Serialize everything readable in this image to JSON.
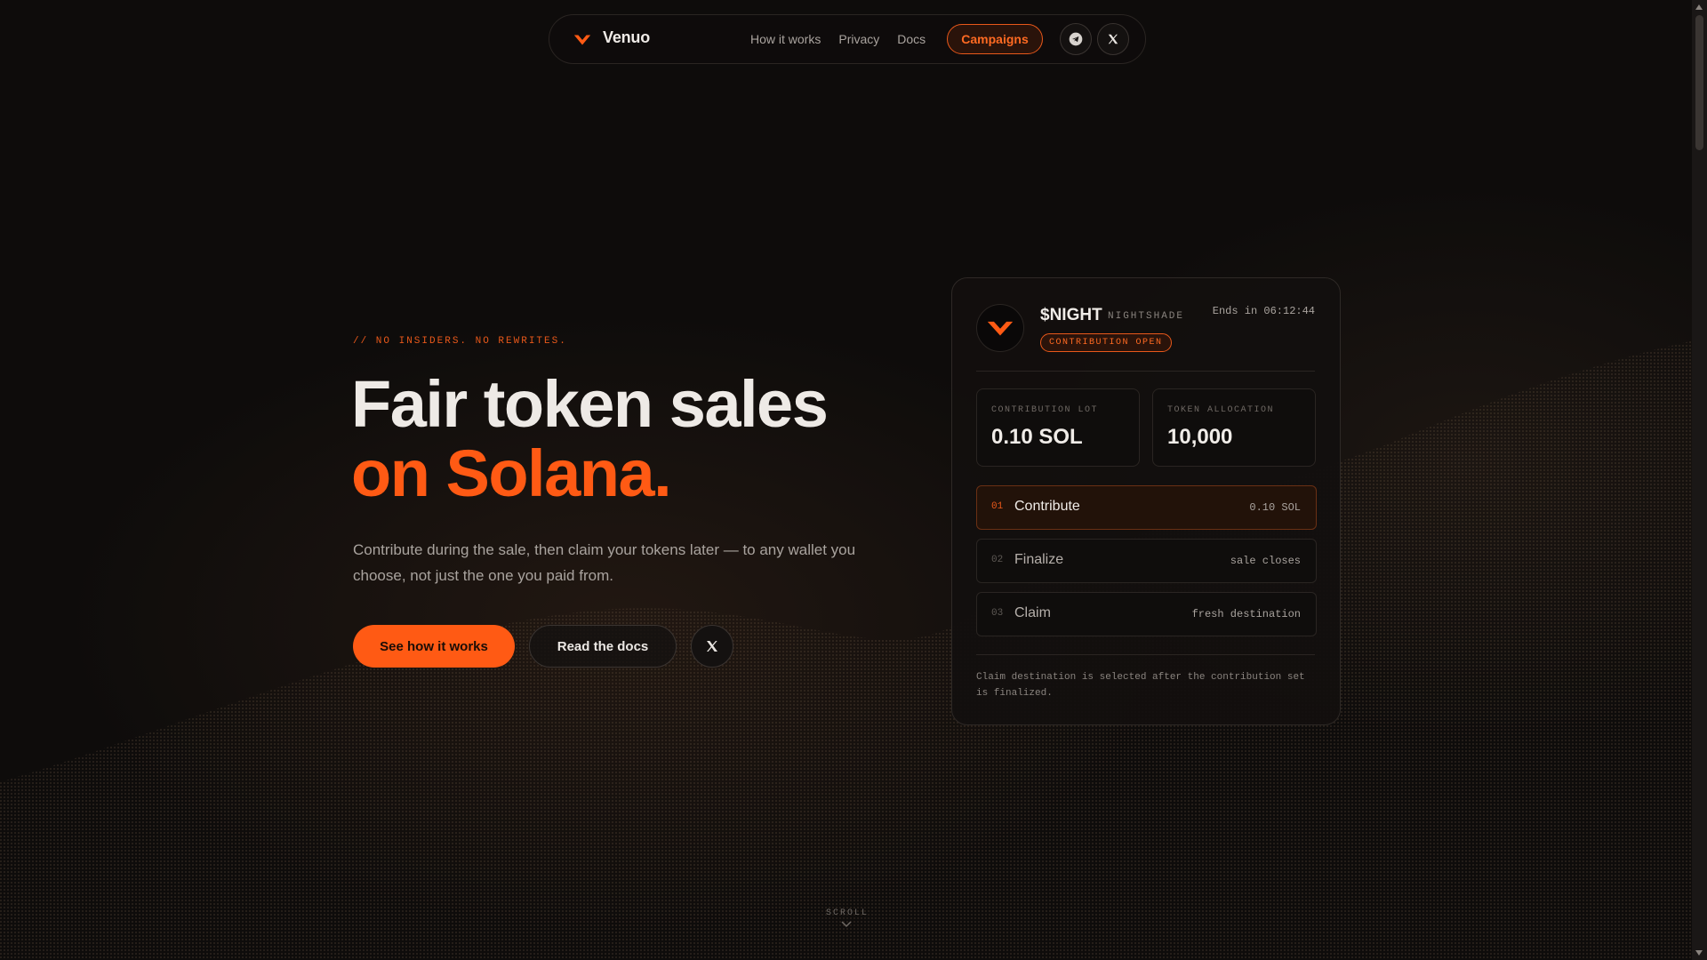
{
  "nav": {
    "brand": "Venuo",
    "links": [
      "How it works",
      "Privacy",
      "Docs"
    ],
    "cta": "Campaigns",
    "icons": [
      "telegram-icon",
      "x-icon"
    ]
  },
  "hero": {
    "eyebrow": "// NO INSIDERS. NO REWRITES.",
    "title_line1": "Fair token sales",
    "title_line2": "on Solana.",
    "subtitle": "Contribute during the sale, then claim your tokens later — to any wallet you choose, not just the one you paid from.",
    "primary_button": "See how it works",
    "secondary_button": "Read the docs"
  },
  "card": {
    "ticker": "$NIGHT",
    "token_name": "NIGHTSHADE",
    "status": "CONTRIBUTION OPEN",
    "ends": "Ends in 06:12:44",
    "stats": [
      {
        "label": "CONTRIBUTION LOT",
        "value": "0.10 SOL"
      },
      {
        "label": "TOKEN ALLOCATION",
        "value": "10,000"
      }
    ],
    "steps": [
      {
        "num": "01",
        "name": "Contribute",
        "meta": "0.10 SOL"
      },
      {
        "num": "02",
        "name": "Finalize",
        "meta": "sale closes"
      },
      {
        "num": "03",
        "name": "Claim",
        "meta": "fresh destination"
      }
    ],
    "note": "Claim destination is selected after the contribution set is finalized."
  },
  "scroll_label": "SCROLL",
  "colors": {
    "accent": "#ff5a14",
    "background": "#0e0c0b"
  }
}
